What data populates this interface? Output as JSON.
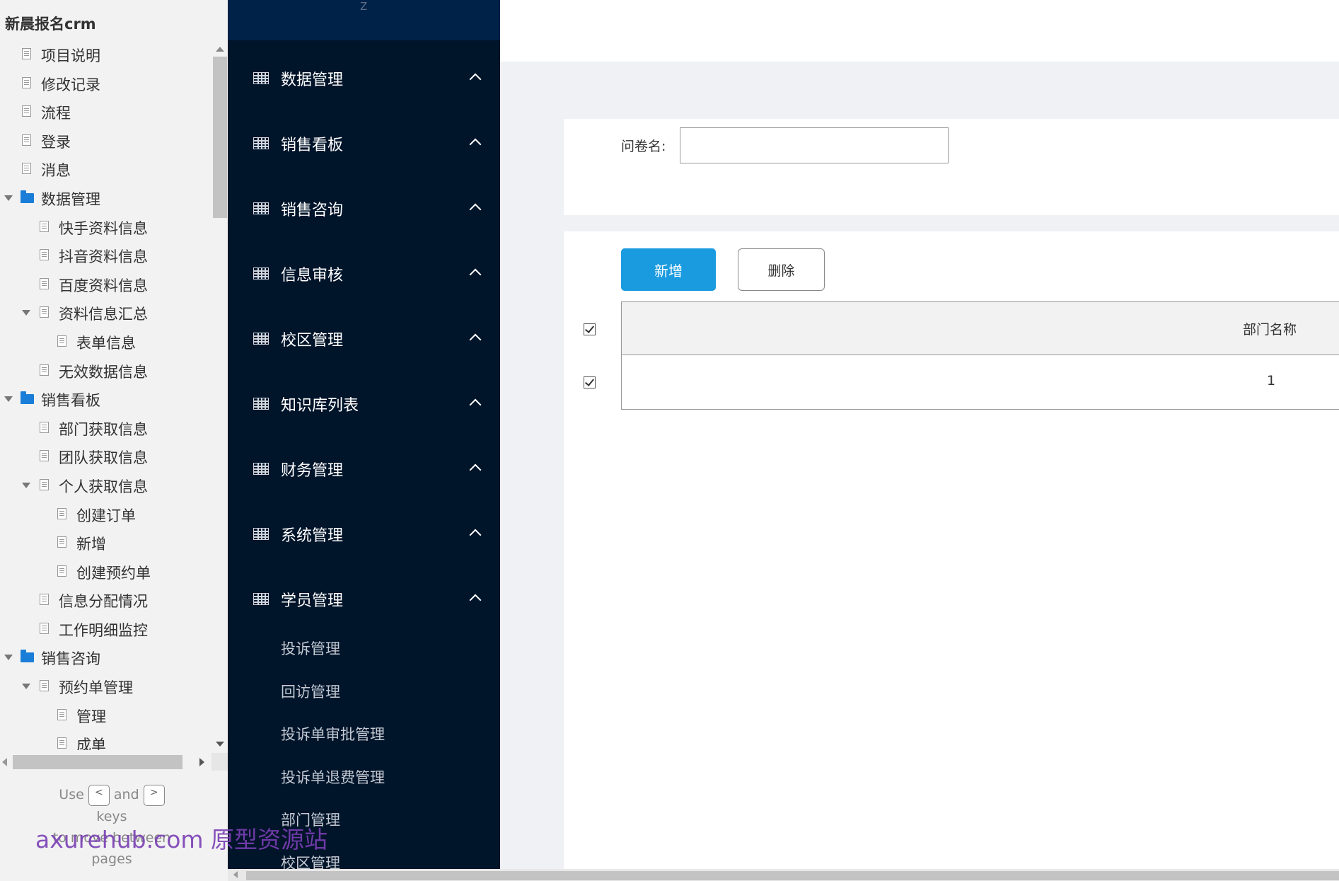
{
  "sitemap": {
    "title": "新晨报名crm",
    "items": [
      {
        "label": "项目说明",
        "level": 0,
        "type": "page",
        "expanded": null
      },
      {
        "label": "修改记录",
        "level": 0,
        "type": "page",
        "expanded": null
      },
      {
        "label": "流程",
        "level": 0,
        "type": "page",
        "expanded": null
      },
      {
        "label": "登录",
        "level": 0,
        "type": "page",
        "expanded": null
      },
      {
        "label": "消息",
        "level": 0,
        "type": "page",
        "expanded": null
      },
      {
        "label": "数据管理",
        "level": 0,
        "type": "folder",
        "expanded": true
      },
      {
        "label": "快手资料信息",
        "level": 1,
        "type": "page",
        "expanded": null
      },
      {
        "label": "抖音资料信息",
        "level": 1,
        "type": "page",
        "expanded": null
      },
      {
        "label": "百度资料信息",
        "level": 1,
        "type": "page",
        "expanded": null
      },
      {
        "label": "资料信息汇总",
        "level": 1,
        "type": "page",
        "expanded": true
      },
      {
        "label": "表单信息",
        "level": 2,
        "type": "page",
        "expanded": null
      },
      {
        "label": "无效数据信息",
        "level": 1,
        "type": "page",
        "expanded": null
      },
      {
        "label": "销售看板",
        "level": 0,
        "type": "folder",
        "expanded": true
      },
      {
        "label": "部门获取信息",
        "level": 1,
        "type": "page",
        "expanded": null
      },
      {
        "label": "团队获取信息",
        "level": 1,
        "type": "page",
        "expanded": null
      },
      {
        "label": "个人获取信息",
        "level": 1,
        "type": "page",
        "expanded": true
      },
      {
        "label": "创建订单",
        "level": 2,
        "type": "page",
        "expanded": null
      },
      {
        "label": "新增",
        "level": 2,
        "type": "page",
        "expanded": null
      },
      {
        "label": "创建预约单",
        "level": 2,
        "type": "page",
        "expanded": null
      },
      {
        "label": "信息分配情况",
        "level": 1,
        "type": "page",
        "expanded": null
      },
      {
        "label": "工作明细监控",
        "level": 1,
        "type": "page",
        "expanded": null
      },
      {
        "label": "销售咨询",
        "level": 0,
        "type": "folder",
        "expanded": true
      },
      {
        "label": "预约单管理",
        "level": 1,
        "type": "page",
        "expanded": true
      },
      {
        "label": "管理",
        "level": 2,
        "type": "page",
        "expanded": null
      },
      {
        "label": "成单",
        "level": 2,
        "type": "page",
        "expanded": null
      }
    ],
    "hint": {
      "use": "Use",
      "key_prev": "<",
      "and": "and",
      "key_next": ">",
      "keys": "keys",
      "to_move": "to move between",
      "pages": "pages"
    }
  },
  "watermark": "axurehub.com 原型资源站",
  "nav": {
    "top_text": "Z",
    "groups": [
      {
        "label": "数据管理",
        "icon": "table-icon"
      },
      {
        "label": "销售看板",
        "icon": "table-icon"
      },
      {
        "label": "销售咨询",
        "icon": "table-icon"
      },
      {
        "label": "信息审核",
        "icon": "table-icon"
      },
      {
        "label": "校区管理",
        "icon": "table-icon"
      },
      {
        "label": "知识库列表",
        "icon": "table-icon"
      },
      {
        "label": "财务管理",
        "icon": "table-icon"
      },
      {
        "label": "系统管理",
        "icon": "table-icon"
      },
      {
        "label": "学员管理",
        "icon": "table-icon"
      }
    ],
    "subitems": [
      "投诉管理",
      "回访管理",
      "投诉单审批管理",
      "投诉单退费管理",
      "部门管理",
      "校区管理"
    ]
  },
  "main": {
    "search_label": "问卷名:",
    "search_value": "",
    "search_placeholder": "",
    "add_button": "新增",
    "delete_button": "删除",
    "table": {
      "columns": [
        "部门名称"
      ],
      "rows": [
        [
          "1"
        ]
      ],
      "header_checked": true,
      "row_checked": [
        true
      ]
    }
  },
  "colors": {
    "nav_bg": "#00142a",
    "nav_top_bg": "#012248",
    "primary_button": "#1a9be0",
    "folder_icon": "#1a7ed8",
    "watermark": "#7a3fb5"
  }
}
